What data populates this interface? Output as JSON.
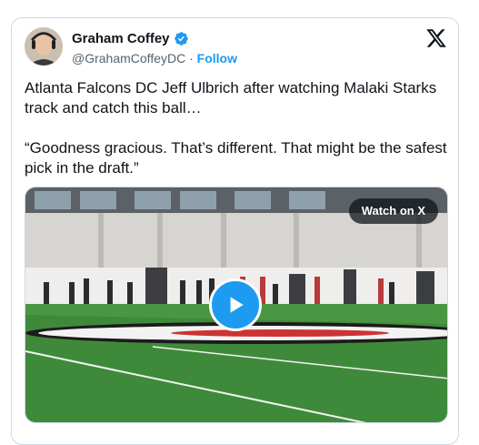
{
  "author": {
    "display_name": "Graham Coffey",
    "handle": "@GrahamCoffeyDC",
    "separator": "·",
    "follow_label": "Follow",
    "verified": true
  },
  "tweet": {
    "text": "Atlanta Falcons DC Jeff Ulbrich after watching Malaki Starks track and catch this ball…\n\n“Goodness gracious. That’s different. That might be the safest pick in the draft.”"
  },
  "media": {
    "watch_label": "Watch on X",
    "play_icon": "play-icon"
  },
  "icons": {
    "brand": "x-logo-icon",
    "verified": "verified-badge-icon"
  },
  "colors": {
    "accent": "#1d9bf0",
    "text": "#0f1419",
    "secondary_text": "#536471",
    "border": "#cfd9de"
  }
}
